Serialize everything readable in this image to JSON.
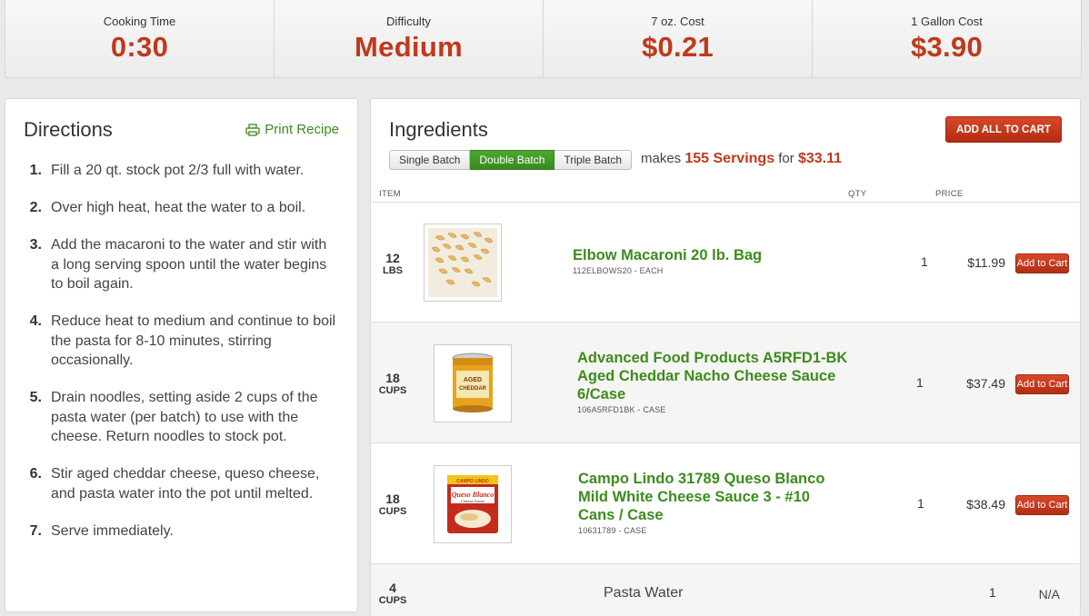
{
  "stats": [
    {
      "label": "Cooking Time",
      "value": "0:30"
    },
    {
      "label": "Difficulty",
      "value": "Medium"
    },
    {
      "label": "7 oz. Cost",
      "value": "$0.21"
    },
    {
      "label": "1 Gallon Cost",
      "value": "$3.90"
    }
  ],
  "directions": {
    "title": "Directions",
    "print_label": "Print Recipe",
    "steps": [
      {
        "num": "1.",
        "text": "Fill a 20 qt. stock pot 2/3 full with water."
      },
      {
        "num": "2.",
        "text": "Over high heat, heat the water to a boil."
      },
      {
        "num": "3.",
        "text": "Add the macaroni to the water and stir with a long serving spoon until the water begins to boil again."
      },
      {
        "num": "4.",
        "text": "Reduce heat to medium and continue to boil the pasta for 8-10 minutes, stirring occasionally."
      },
      {
        "num": "5.",
        "text": "Drain noodles, setting aside 2 cups of the pasta water (per batch) to use with the cheese. Return noodles to stock pot."
      },
      {
        "num": "6.",
        "text": "Stir aged cheddar cheese, queso cheese, and pasta water into the pot until melted."
      },
      {
        "num": "7.",
        "text": "Serve immediately."
      }
    ]
  },
  "ingredients": {
    "title": "Ingredients",
    "add_all_label": "ADD ALL TO CART",
    "batches": [
      "Single Batch",
      "Double Batch",
      "Triple Batch"
    ],
    "active_batch": "Double Batch",
    "makes_prefix": "makes",
    "servings": "155 Servings",
    "makes_for": "for",
    "total": "$33.11",
    "columns": {
      "item": "ITEM",
      "qty": "QTY",
      "price": "PRICE"
    },
    "items": [
      {
        "amount": "12",
        "unit": "LBS",
        "name_lines": [
          "Elbow Macaroni 20 lb. Bag"
        ],
        "sku": "112ELBOWS20 - EACH",
        "qty": "1",
        "price": "$11.99",
        "button": "Add to Cart",
        "image": "macaroni-photo"
      },
      {
        "amount": "18",
        "unit": "CUPS",
        "name_lines": [
          "Advanced Food Products A5RFD1-BK",
          "Aged Cheddar Nacho Cheese Sauce",
          "6/Case"
        ],
        "sku": "106A5RFD1BK - CASE",
        "qty": "1",
        "price": "$37.49",
        "button": "Add to Cart",
        "image": "cheddar-can-photo"
      },
      {
        "amount": "18",
        "unit": "CUPS",
        "name_lines": [
          "Campo Lindo 31789 Queso Blanco",
          "Mild White Cheese Sauce 3 - #10",
          "Cans / Case"
        ],
        "sku": "10631789 - CASE",
        "qty": "1",
        "price": "$38.49",
        "button": "Add to Cart",
        "image": "queso-can-photo"
      },
      {
        "amount": "4",
        "unit": "CUPS",
        "name": "Pasta Water",
        "qty": "1",
        "price": "N/A"
      }
    ]
  },
  "image_text": {
    "cheddar_can": [
      "AGED",
      "CHEDDAR"
    ],
    "queso_can": [
      "CAMPO LINDO",
      "Queso Blanco",
      "Cheese Sauce"
    ]
  },
  "colors": {
    "accent_red": "#c0391b",
    "link_green": "#3d8b1d",
    "active_green": "#4ea72e"
  }
}
